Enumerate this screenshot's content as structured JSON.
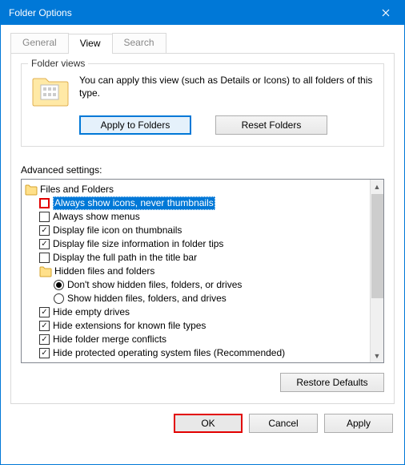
{
  "window": {
    "title": "Folder Options"
  },
  "tabs": {
    "general": "General",
    "view": "View",
    "search": "Search"
  },
  "folder_views": {
    "legend": "Folder views",
    "desc": "You can apply this view (such as Details or Icons) to all folders of this type.",
    "apply": "Apply to Folders",
    "reset": "Reset Folders"
  },
  "advanced": {
    "label": "Advanced settings:",
    "root": "Files and Folders",
    "items": [
      {
        "label": "Always show icons, never thumbnails",
        "type": "checkbox",
        "checked": false,
        "highlight": true
      },
      {
        "label": "Always show menus",
        "type": "checkbox",
        "checked": false
      },
      {
        "label": "Display file icon on thumbnails",
        "type": "checkbox",
        "checked": true
      },
      {
        "label": "Display file size information in folder tips",
        "type": "checkbox",
        "checked": true
      },
      {
        "label": "Display the full path in the title bar",
        "type": "checkbox",
        "checked": false
      }
    ],
    "hidden_group": "Hidden files and folders",
    "hidden_options": [
      {
        "label": "Don't show hidden files, folders, or drives",
        "selected": true
      },
      {
        "label": "Show hidden files, folders, and drives",
        "selected": false
      }
    ],
    "items2": [
      {
        "label": "Hide empty drives",
        "checked": true
      },
      {
        "label": "Hide extensions for known file types",
        "checked": true
      },
      {
        "label": "Hide folder merge conflicts",
        "checked": true
      },
      {
        "label": "Hide protected operating system files (Recommended)",
        "checked": true
      }
    ]
  },
  "buttons": {
    "restore": "Restore Defaults",
    "ok": "OK",
    "cancel": "Cancel",
    "apply": "Apply"
  }
}
